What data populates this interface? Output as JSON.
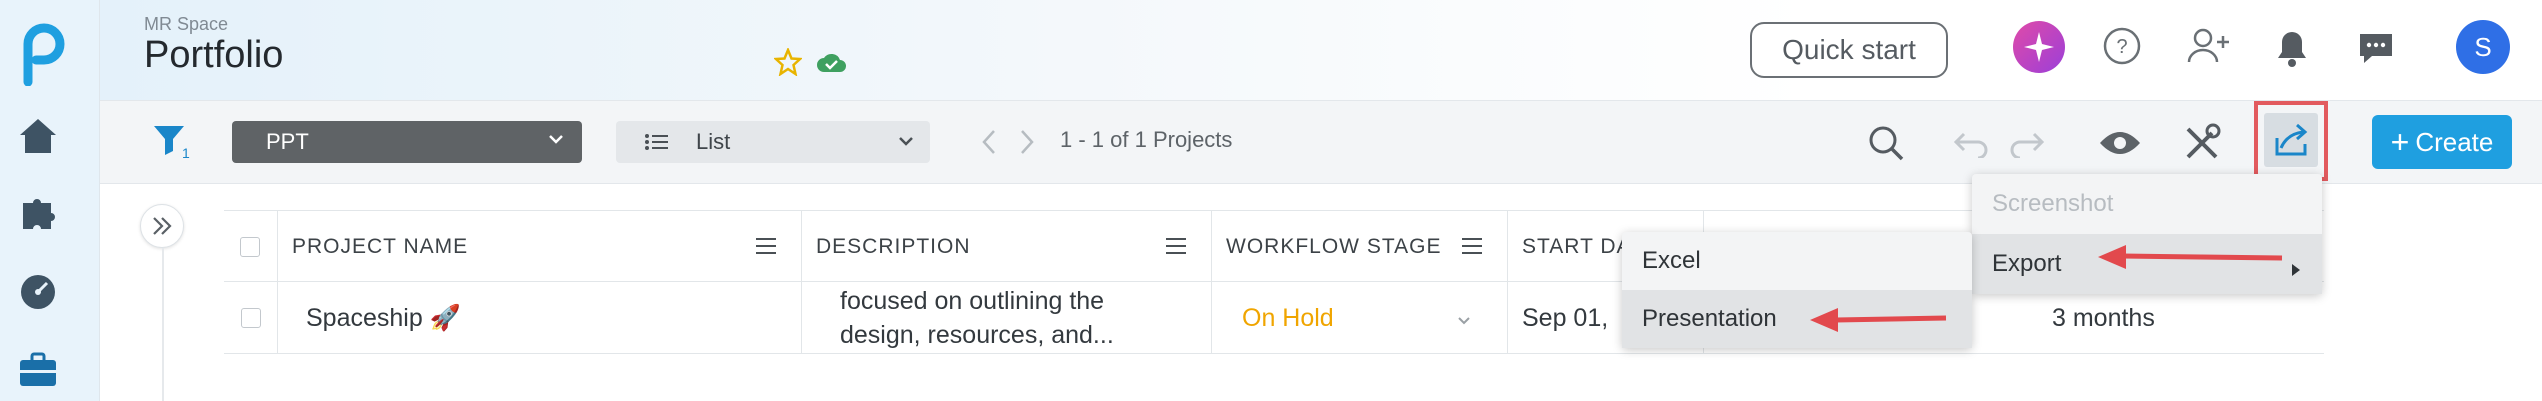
{
  "header": {
    "workspace": "MR Space",
    "title": "Portfolio",
    "quick_start": "Quick start",
    "avatar_initial": "S"
  },
  "toolbar": {
    "filter_count": "1",
    "view_select": "PPT",
    "layout_select": "List",
    "pager": "1 - 1 of 1 Projects",
    "create_label": "Create"
  },
  "table": {
    "columns": [
      "PROJECT NAME",
      "DESCRIPTION",
      "WORKFLOW STAGE",
      "START DA"
    ],
    "row": {
      "name": "Spaceship 🚀",
      "description_line1": "focused on outlining the",
      "description_line2": "design, resources, and...",
      "stage": "On Hold",
      "start": "Sep 01,",
      "duration": "3 months"
    }
  },
  "share_menu": {
    "items": [
      "Screenshot",
      "Export"
    ]
  },
  "export_submenu": {
    "items": [
      "Excel",
      "Presentation"
    ]
  },
  "colors": {
    "accent": "#1f9fe0",
    "highlight": "#e25a5e",
    "on_hold": "#f0a500"
  }
}
